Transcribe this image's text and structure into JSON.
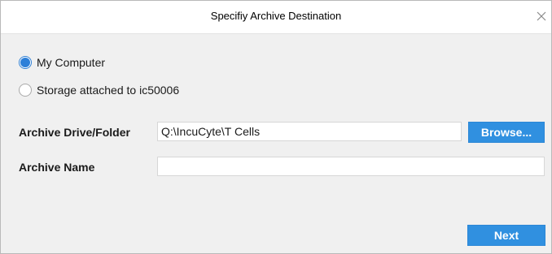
{
  "window": {
    "title": "Specifiy Archive Destination",
    "close_icon": "close-icon"
  },
  "destination": {
    "options": [
      {
        "label": "My Computer",
        "selected": true
      },
      {
        "label": "Storage attached to ic50006",
        "selected": false
      }
    ]
  },
  "form": {
    "folder_label": "Archive Drive/Folder",
    "folder_value": "Q:\\IncuCyte\\T Cells",
    "browse_label": "Browse...",
    "name_label": "Archive Name",
    "name_value": ""
  },
  "footer": {
    "next_label": "Next"
  },
  "colors": {
    "accent": "#3090e0",
    "background": "#f0f0f0"
  }
}
